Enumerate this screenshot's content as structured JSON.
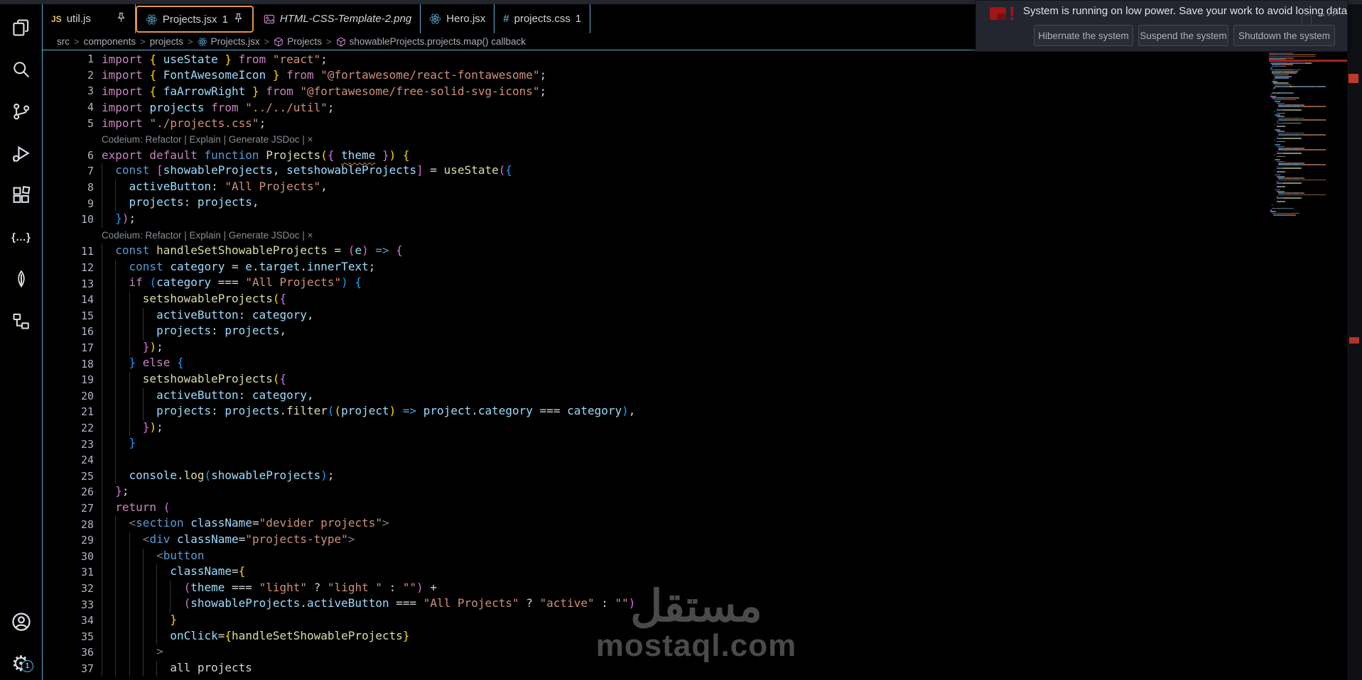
{
  "colors": {
    "accent_border_blue": "#5fb0d4",
    "active_tab_orange": "#e0954a",
    "error_red": "#c0392b",
    "squiggle_orange": "#cf9347",
    "watermark_grey": "#4a4a4c"
  },
  "activity_bar": {
    "items": [
      {
        "name": "explorer"
      },
      {
        "name": "search"
      },
      {
        "name": "source-control"
      },
      {
        "name": "run-debug"
      },
      {
        "name": "extensions"
      },
      {
        "name": "braces"
      },
      {
        "name": "mongodb"
      },
      {
        "name": "flow"
      }
    ],
    "bottom": [
      {
        "name": "account"
      },
      {
        "name": "settings"
      }
    ],
    "settings_badge": "1"
  },
  "tabs": [
    {
      "label": "util.js",
      "icon": "js",
      "pinned": true,
      "active": false,
      "preview": false,
      "badge": ""
    },
    {
      "label": "Projects.jsx",
      "icon": "react",
      "pinned": true,
      "active": true,
      "preview": false,
      "badge": "1"
    },
    {
      "label": "HTML-CSS-Template-2.png",
      "icon": "image",
      "pinned": false,
      "active": false,
      "preview": true,
      "badge": ""
    },
    {
      "label": "Hero.jsx",
      "icon": "react",
      "pinned": false,
      "active": false,
      "preview": false,
      "badge": ""
    },
    {
      "label": "projects.css",
      "icon": "css",
      "pinned": false,
      "active": false,
      "preview": false,
      "badge": "1"
    }
  ],
  "breadcrumb": {
    "separator": ">",
    "items": [
      {
        "label": "src",
        "icon": ""
      },
      {
        "label": "components",
        "icon": ""
      },
      {
        "label": "projects",
        "icon": ""
      },
      {
        "label": "Projects.jsx",
        "icon": "react"
      },
      {
        "label": "Projects",
        "icon": "symbol"
      },
      {
        "label": "showableProjects.projects.map() callback",
        "icon": "symbol"
      }
    ]
  },
  "notification": {
    "message": "System is running on low power. Save your work to avoid losing data",
    "buttons": [
      "Hibernate the system",
      "Suspend the system",
      "Shutdown the system"
    ],
    "more_icon": "...",
    "icon": "low-power-red-alert"
  },
  "watermark": {
    "arabic": "مستقل",
    "latin": "mostaql.com"
  },
  "editor": {
    "codeium_hint": "Codeium: Refactor | Explain | Generate JSDoc | ×",
    "lines": [
      {
        "n": 1,
        "i": 0,
        "t": [
          [
            "k",
            "import "
          ],
          [
            "b1",
            "{ "
          ],
          [
            "v",
            "useState"
          ],
          [
            "b1",
            " }"
          ],
          [
            "k",
            " from "
          ],
          [
            "s",
            "\"react\""
          ],
          [
            "p",
            ";"
          ]
        ]
      },
      {
        "n": 2,
        "i": 0,
        "t": [
          [
            "k",
            "import "
          ],
          [
            "b1",
            "{ "
          ],
          [
            "v",
            "FontAwesomeIcon"
          ],
          [
            "b1",
            " }"
          ],
          [
            "k",
            " from "
          ],
          [
            "s",
            "\"@fortawesome/react-fontawesome\""
          ],
          [
            "p",
            ";"
          ]
        ]
      },
      {
        "n": 3,
        "i": 0,
        "t": [
          [
            "k",
            "import "
          ],
          [
            "b1",
            "{ "
          ],
          [
            "v",
            "faArrowRight"
          ],
          [
            "b1",
            " }"
          ],
          [
            "k",
            " from "
          ],
          [
            "s",
            "\"@fortawesome/free-solid-svg-icons\""
          ],
          [
            "p",
            ";"
          ]
        ]
      },
      {
        "n": 4,
        "i": 0,
        "t": [
          [
            "k",
            "import "
          ],
          [
            "v",
            "projects"
          ],
          [
            "k",
            " from "
          ],
          [
            "s",
            "\"../../util\""
          ],
          [
            "p",
            ";"
          ]
        ]
      },
      {
        "n": 5,
        "i": 0,
        "t": [
          [
            "k",
            "import "
          ],
          [
            "s",
            "\"./projects.css\""
          ],
          [
            "p",
            ";"
          ]
        ]
      },
      {
        "w": true
      },
      {
        "n": 6,
        "i": 0,
        "t": [
          [
            "k",
            "export default "
          ],
          [
            "d",
            "function "
          ],
          [
            "f",
            "Projects"
          ],
          [
            "b1",
            "("
          ],
          [
            "b2",
            "{ "
          ],
          [
            "sq",
            "theme"
          ],
          [
            "b2",
            " }"
          ],
          [
            "b1",
            ")"
          ],
          [
            "p",
            " "
          ],
          [
            "b1",
            "{"
          ]
        ]
      },
      {
        "n": 7,
        "i": 1,
        "t": [
          [
            "d",
            "const "
          ],
          [
            "b2",
            "["
          ],
          [
            "v",
            "showableProjects"
          ],
          [
            "p",
            ", "
          ],
          [
            "v",
            "setshowableProjects"
          ],
          [
            "b2",
            "]"
          ],
          [
            "p",
            " = "
          ],
          [
            "f",
            "useState"
          ],
          [
            "b2",
            "("
          ],
          [
            "b3",
            "{"
          ]
        ]
      },
      {
        "n": 8,
        "i": 2,
        "t": [
          [
            "v",
            "activeButton"
          ],
          [
            "p",
            ": "
          ],
          [
            "s",
            "\"All Projects\""
          ],
          [
            "p",
            ","
          ]
        ]
      },
      {
        "n": 9,
        "i": 2,
        "t": [
          [
            "v",
            "projects"
          ],
          [
            "p",
            ": "
          ],
          [
            "v",
            "projects"
          ],
          [
            "p",
            ","
          ]
        ]
      },
      {
        "n": 10,
        "i": 1,
        "t": [
          [
            "b3",
            "}"
          ],
          [
            "b2",
            ")"
          ],
          [
            "p",
            ";"
          ]
        ]
      },
      {
        "w": true
      },
      {
        "n": 11,
        "i": 1,
        "t": [
          [
            "d",
            "const "
          ],
          [
            "f",
            "handleSetShowableProjects"
          ],
          [
            "p",
            " = "
          ],
          [
            "b2",
            "("
          ],
          [
            "v",
            "e"
          ],
          [
            "b2",
            ")"
          ],
          [
            "d",
            " => "
          ],
          [
            "b2",
            "{"
          ]
        ]
      },
      {
        "n": 12,
        "i": 2,
        "t": [
          [
            "d",
            "const "
          ],
          [
            "v",
            "category"
          ],
          [
            "p",
            " = "
          ],
          [
            "v",
            "e"
          ],
          [
            "p",
            "."
          ],
          [
            "v",
            "target"
          ],
          [
            "p",
            "."
          ],
          [
            "v",
            "innerText"
          ],
          [
            "p",
            ";"
          ]
        ]
      },
      {
        "n": 13,
        "i": 2,
        "t": [
          [
            "k",
            "if "
          ],
          [
            "b3",
            "("
          ],
          [
            "v",
            "category"
          ],
          [
            "p",
            " === "
          ],
          [
            "s",
            "\"All Projects\""
          ],
          [
            "b3",
            ")"
          ],
          [
            "p",
            " "
          ],
          [
            "b3",
            "{"
          ]
        ]
      },
      {
        "n": 14,
        "i": 3,
        "t": [
          [
            "f",
            "setshowableProjects"
          ],
          [
            "b1",
            "("
          ],
          [
            "b2",
            "{"
          ]
        ]
      },
      {
        "n": 15,
        "i": 4,
        "t": [
          [
            "v",
            "activeButton"
          ],
          [
            "p",
            ": "
          ],
          [
            "v",
            "category"
          ],
          [
            "p",
            ","
          ]
        ]
      },
      {
        "n": 16,
        "i": 4,
        "t": [
          [
            "v",
            "projects"
          ],
          [
            "p",
            ": "
          ],
          [
            "v",
            "projects"
          ],
          [
            "p",
            ","
          ]
        ]
      },
      {
        "n": 17,
        "i": 3,
        "t": [
          [
            "b2",
            "}"
          ],
          [
            "b1",
            ")"
          ],
          [
            "p",
            ";"
          ]
        ]
      },
      {
        "n": 18,
        "i": 2,
        "t": [
          [
            "b3",
            "} "
          ],
          [
            "k",
            "else"
          ],
          [
            "b3",
            " {"
          ]
        ]
      },
      {
        "n": 19,
        "i": 3,
        "t": [
          [
            "f",
            "setshowableProjects"
          ],
          [
            "b1",
            "("
          ],
          [
            "b2",
            "{"
          ]
        ]
      },
      {
        "n": 20,
        "i": 4,
        "t": [
          [
            "v",
            "activeButton"
          ],
          [
            "p",
            ": "
          ],
          [
            "v",
            "category"
          ],
          [
            "p",
            ","
          ]
        ]
      },
      {
        "n": 21,
        "i": 4,
        "t": [
          [
            "v",
            "projects"
          ],
          [
            "p",
            ": "
          ],
          [
            "v",
            "projects"
          ],
          [
            "p",
            "."
          ],
          [
            "f",
            "filter"
          ],
          [
            "b3",
            "("
          ],
          [
            "b1",
            "("
          ],
          [
            "v",
            "project"
          ],
          [
            "b1",
            ")"
          ],
          [
            "d",
            " => "
          ],
          [
            "v",
            "project"
          ],
          [
            "p",
            "."
          ],
          [
            "v",
            "category"
          ],
          [
            "p",
            " === "
          ],
          [
            "v",
            "category"
          ],
          [
            "b3",
            ")"
          ],
          [
            "p",
            ","
          ]
        ]
      },
      {
        "n": 22,
        "i": 3,
        "t": [
          [
            "b2",
            "}"
          ],
          [
            "b1",
            ")"
          ],
          [
            "p",
            ";"
          ]
        ]
      },
      {
        "n": 23,
        "i": 2,
        "t": [
          [
            "b3",
            "}"
          ]
        ]
      },
      {
        "n": 24,
        "i": 2,
        "t": []
      },
      {
        "n": 25,
        "i": 2,
        "t": [
          [
            "v",
            "console"
          ],
          [
            "p",
            "."
          ],
          [
            "f",
            "log"
          ],
          [
            "b3",
            "("
          ],
          [
            "v",
            "showableProjects"
          ],
          [
            "b3",
            ")"
          ],
          [
            "p",
            ";"
          ]
        ]
      },
      {
        "n": 26,
        "i": 1,
        "t": [
          [
            "b2",
            "}"
          ],
          [
            "p",
            ";"
          ]
        ]
      },
      {
        "n": 27,
        "i": 1,
        "t": [
          [
            "k",
            "return "
          ],
          [
            "b2",
            "("
          ]
        ]
      },
      {
        "n": 28,
        "i": 2,
        "t": [
          [
            "t",
            "<"
          ],
          [
            "d",
            "section"
          ],
          [
            "p",
            " "
          ],
          [
            "v",
            "className"
          ],
          [
            "p",
            "="
          ],
          [
            "s",
            "\"devider projects\""
          ],
          [
            "t",
            ">"
          ]
        ]
      },
      {
        "n": 29,
        "i": 3,
        "t": [
          [
            "t",
            "<"
          ],
          [
            "d",
            "div"
          ],
          [
            "p",
            " "
          ],
          [
            "v",
            "className"
          ],
          [
            "p",
            "="
          ],
          [
            "s",
            "\"projects-type\""
          ],
          [
            "t",
            ">"
          ]
        ]
      },
      {
        "n": 30,
        "i": 4,
        "t": [
          [
            "t",
            "<"
          ],
          [
            "d",
            "button"
          ]
        ]
      },
      {
        "n": 31,
        "i": 5,
        "t": [
          [
            "v",
            "className"
          ],
          [
            "p",
            "="
          ],
          [
            "b1",
            "{"
          ]
        ]
      },
      {
        "n": 32,
        "i": 6,
        "t": [
          [
            "b2",
            "("
          ],
          [
            "v",
            "theme"
          ],
          [
            "p",
            " === "
          ],
          [
            "s",
            "\"light\""
          ],
          [
            "p",
            " ? "
          ],
          [
            "s",
            "\"light \""
          ],
          [
            "p",
            " : "
          ],
          [
            "s",
            "\"\""
          ],
          [
            "b2",
            ")"
          ],
          [
            "p",
            " +"
          ]
        ]
      },
      {
        "n": 33,
        "i": 6,
        "t": [
          [
            "b2",
            "("
          ],
          [
            "v",
            "showableProjects"
          ],
          [
            "p",
            "."
          ],
          [
            "v",
            "activeButton"
          ],
          [
            "p",
            " === "
          ],
          [
            "s",
            "\"All Projects\""
          ],
          [
            "p",
            " ? "
          ],
          [
            "s",
            "\"active\""
          ],
          [
            "p",
            " : "
          ],
          [
            "s",
            "\"\""
          ],
          [
            "b2",
            ")"
          ]
        ]
      },
      {
        "n": 34,
        "i": 5,
        "t": [
          [
            "b1",
            "}"
          ]
        ]
      },
      {
        "n": 35,
        "i": 5,
        "t": [
          [
            "v",
            "onClick"
          ],
          [
            "p",
            "="
          ],
          [
            "b1",
            "{"
          ],
          [
            "f",
            "handleSetShowableProjects"
          ],
          [
            "b1",
            "}"
          ]
        ]
      },
      {
        "n": 36,
        "i": 4,
        "t": [
          [
            "t",
            ">"
          ]
        ]
      },
      {
        "n": 37,
        "i": 5,
        "t": [
          [
            "w",
            "all projects"
          ]
        ]
      }
    ]
  }
}
